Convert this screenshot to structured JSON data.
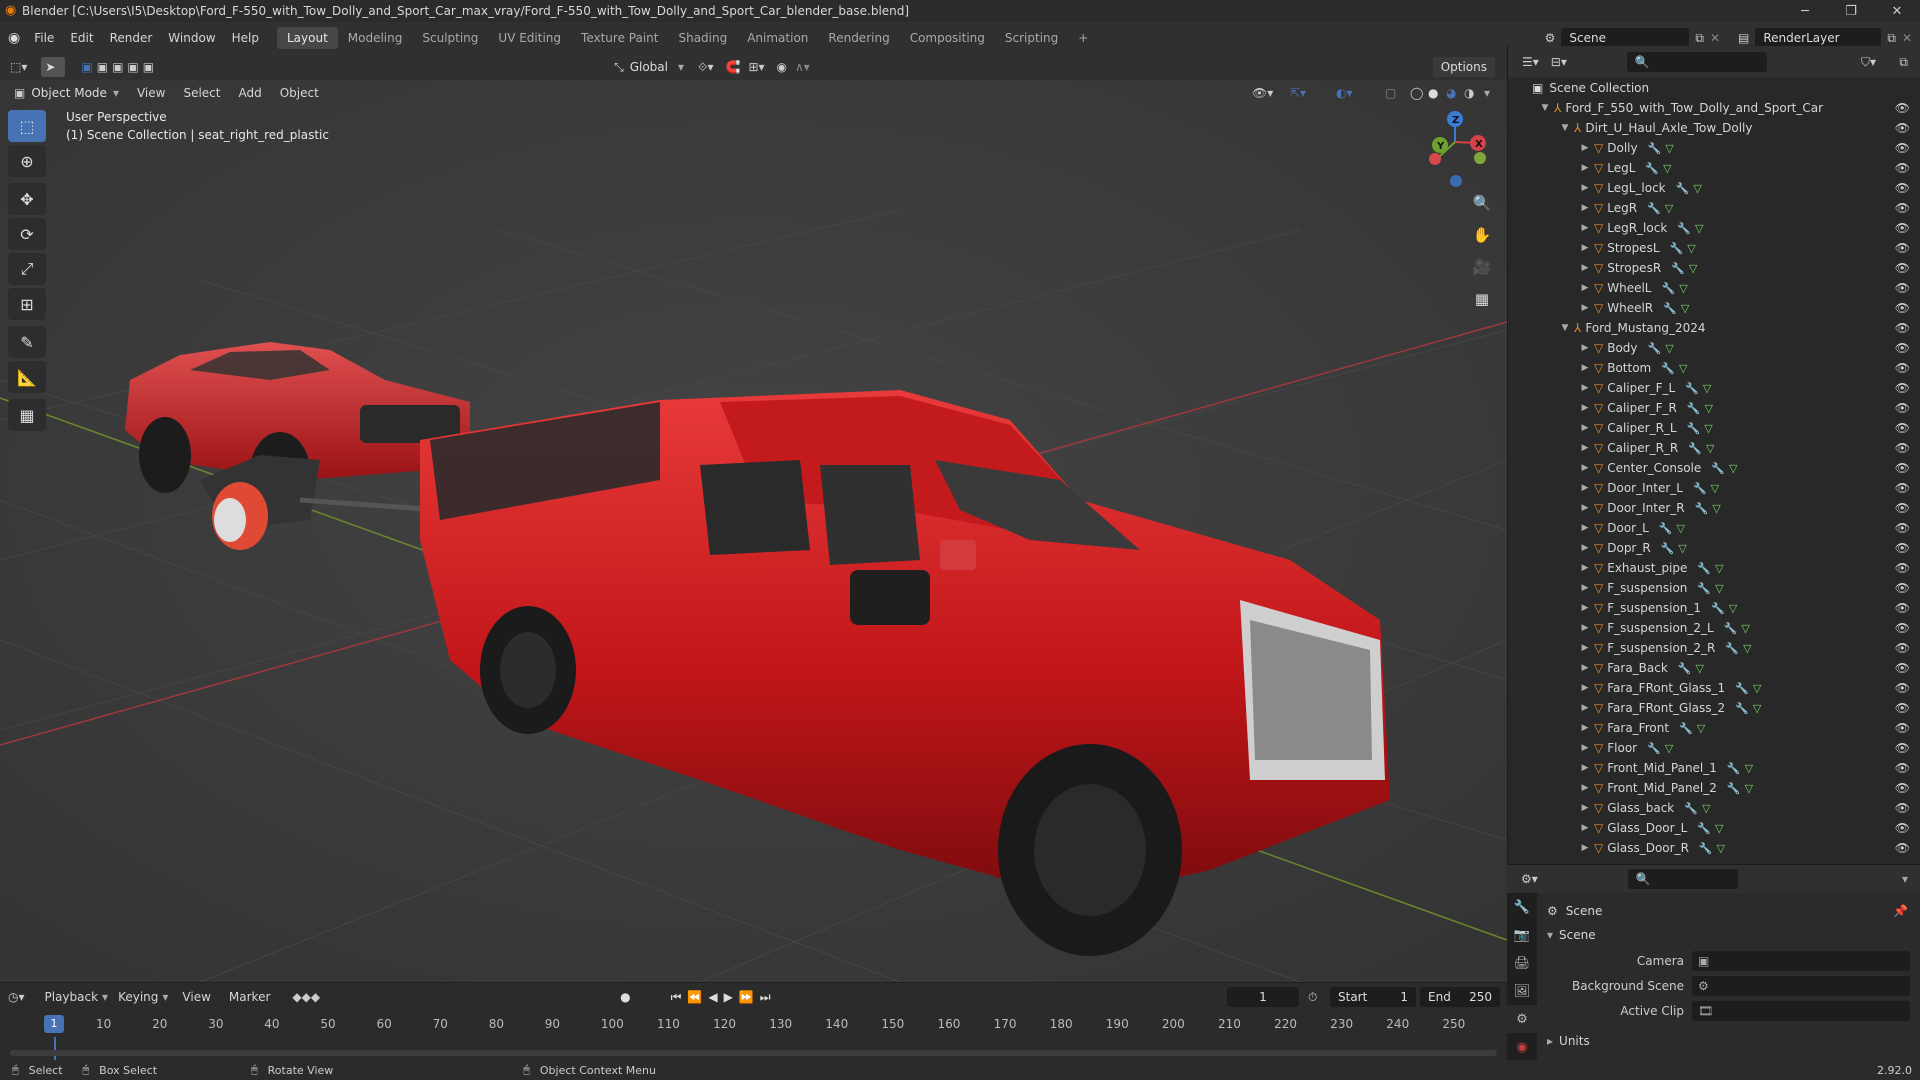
{
  "title_bar": {
    "title": "Blender [C:\\Users\\I5\\Desktop\\Ford_F-550_with_Tow_Dolly_and_Sport_Car_max_vray/Ford_F-550_with_Tow_Dolly_and_Sport_Car_blender_base.blend]",
    "minimize": "─",
    "maximize": "❐",
    "close": "✕"
  },
  "menu": {
    "items": [
      "File",
      "Edit",
      "Render",
      "Window",
      "Help"
    ],
    "workspaces": [
      "Layout",
      "Modeling",
      "Sculpting",
      "UV Editing",
      "Texture Paint",
      "Shading",
      "Animation",
      "Rendering",
      "Compositing",
      "Scripting"
    ],
    "active_workspace": "Layout",
    "add_tab": "+",
    "scene": "Scene",
    "render_layer": "RenderLayer"
  },
  "tool_header": {
    "orientation": "Global",
    "options": "Options"
  },
  "viewport": {
    "mode": "Object Mode",
    "menu": [
      "View",
      "Select",
      "Add",
      "Object"
    ],
    "overlay_line1": "User Perspective",
    "overlay_line2": "(1) Scene Collection | seat_right_red_plastic",
    "gizmo": {
      "x": "X",
      "y": "Y",
      "z": "Z"
    }
  },
  "timeline": {
    "menu": [
      "Playback",
      "Keying",
      "View",
      "Marker"
    ],
    "current_frame": "1",
    "start_label": "Start",
    "start": "1",
    "end_label": "End",
    "end": "250",
    "ticks": [
      "10",
      "20",
      "30",
      "40",
      "50",
      "60",
      "70",
      "80",
      "90",
      "100",
      "110",
      "120",
      "130",
      "140",
      "150",
      "160",
      "170",
      "180",
      "190",
      "200",
      "210",
      "220",
      "230",
      "240",
      "250"
    ],
    "cursor_frame": "1"
  },
  "status_bar": {
    "select": "Select",
    "box_select": "Box Select",
    "rotate_view": "Rotate View",
    "context_menu": "Object Context Menu",
    "version": "2.92.0"
  },
  "outliner": {
    "root": "Scene Collection",
    "rows": [
      {
        "label": "Ford_F_550_with_Tow_Dolly_and_Sport_Car",
        "depth": 1,
        "type": "empty"
      },
      {
        "label": "Dirt_U_Haul_Axle_Tow_Dolly",
        "depth": 2,
        "type": "empty"
      },
      {
        "label": "Dolly",
        "depth": 3,
        "type": "mesh"
      },
      {
        "label": "LegL",
        "depth": 3,
        "type": "mesh"
      },
      {
        "label": "LegL_lock",
        "depth": 3,
        "type": "mesh"
      },
      {
        "label": "LegR",
        "depth": 3,
        "type": "mesh"
      },
      {
        "label": "LegR_lock",
        "depth": 3,
        "type": "mesh"
      },
      {
        "label": "StropesL",
        "depth": 3,
        "type": "mesh"
      },
      {
        "label": "StropesR",
        "depth": 3,
        "type": "mesh"
      },
      {
        "label": "WheelL",
        "depth": 3,
        "type": "mesh"
      },
      {
        "label": "WheelR",
        "depth": 3,
        "type": "mesh"
      },
      {
        "label": "Ford_Mustang_2024",
        "depth": 2,
        "type": "empty"
      },
      {
        "label": "Body",
        "depth": 3,
        "type": "mesh"
      },
      {
        "label": "Bottom",
        "depth": 3,
        "type": "mesh"
      },
      {
        "label": "Caliper_F_L",
        "depth": 3,
        "type": "mesh"
      },
      {
        "label": "Caliper_F_R",
        "depth": 3,
        "type": "mesh"
      },
      {
        "label": "Caliper_R_L",
        "depth": 3,
        "type": "mesh"
      },
      {
        "label": "Caliper_R_R",
        "depth": 3,
        "type": "mesh"
      },
      {
        "label": "Center_Console",
        "depth": 3,
        "type": "mesh"
      },
      {
        "label": "Door_Inter_L",
        "depth": 3,
        "type": "mesh"
      },
      {
        "label": "Door_Inter_R",
        "depth": 3,
        "type": "mesh"
      },
      {
        "label": "Door_L",
        "depth": 3,
        "type": "mesh"
      },
      {
        "label": "Dopr_R",
        "depth": 3,
        "type": "mesh"
      },
      {
        "label": "Exhaust_pipe",
        "depth": 3,
        "type": "mesh"
      },
      {
        "label": "F_suspension",
        "depth": 3,
        "type": "mesh"
      },
      {
        "label": "F_suspension_1",
        "depth": 3,
        "type": "mesh"
      },
      {
        "label": "F_suspension_2_L",
        "depth": 3,
        "type": "mesh"
      },
      {
        "label": "F_suspension_2_R",
        "depth": 3,
        "type": "mesh"
      },
      {
        "label": "Fara_Back",
        "depth": 3,
        "type": "mesh"
      },
      {
        "label": "Fara_FRont_Glass_1",
        "depth": 3,
        "type": "mesh"
      },
      {
        "label": "Fara_FRont_Glass_2",
        "depth": 3,
        "type": "mesh"
      },
      {
        "label": "Fara_Front",
        "depth": 3,
        "type": "mesh"
      },
      {
        "label": "Floor",
        "depth": 3,
        "type": "mesh"
      },
      {
        "label": "Front_Mid_Panel_1",
        "depth": 3,
        "type": "mesh"
      },
      {
        "label": "Front_Mid_Panel_2",
        "depth": 3,
        "type": "mesh"
      },
      {
        "label": "Glass_back",
        "depth": 3,
        "type": "mesh"
      },
      {
        "label": "Glass_Door_L",
        "depth": 3,
        "type": "mesh"
      },
      {
        "label": "Glass_Door_R",
        "depth": 3,
        "type": "mesh"
      }
    ]
  },
  "properties": {
    "context": "Scene",
    "panel": "Scene",
    "camera_label": "Camera",
    "background_label": "Background Scene",
    "clip_label": "Active Clip",
    "units_panel": "Units"
  },
  "colors": {
    "accent": "#4772b3",
    "truck_red": "#c8171b",
    "object_orange": "#e38a2f",
    "mesh_green": "#7bd36a"
  }
}
